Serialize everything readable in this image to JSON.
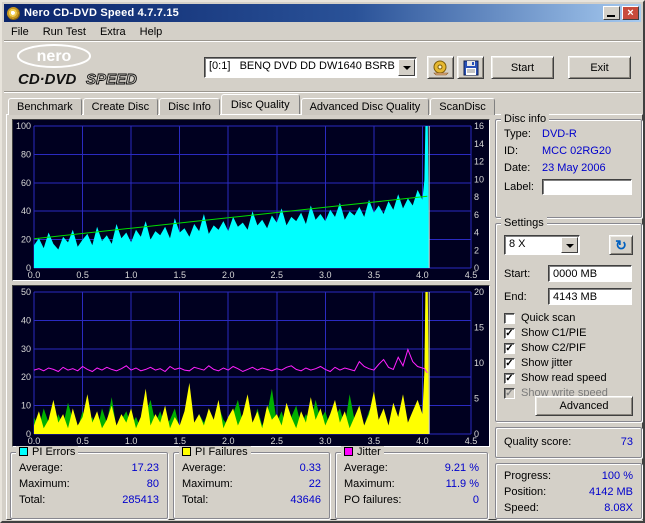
{
  "window": {
    "title": "Nero CD-DVD Speed 4.7.7.15"
  },
  "menu": {
    "items": [
      "File",
      "Run Test",
      "Extra",
      "Help"
    ]
  },
  "logo": {
    "brand": "nero",
    "cd": "CD·DVD",
    "speed": "SPEED"
  },
  "toolbar": {
    "drive": "[0:1]   BENQ DVD DD DW1640 BSRB",
    "start": "Start",
    "exit": "Exit"
  },
  "tabs": [
    "Benchmark",
    "Create Disc",
    "Disc Info",
    "Disc Quality",
    "Advanced Disc Quality",
    "ScanDisc"
  ],
  "disc_info": {
    "title": "Disc info",
    "type_label": "Type:",
    "type": "DVD-R",
    "id_label": "ID:",
    "id": "MCC 02RG20",
    "date_label": "Date:",
    "date": "23 May 2006",
    "label_label": "Label:",
    "label_value": ""
  },
  "settings": {
    "title": "Settings",
    "speed": "8 X",
    "start_label": "Start:",
    "start_value": "0000 MB",
    "end_label": "End:",
    "end_value": "4143 MB",
    "checkboxes": [
      {
        "label": "Quick scan",
        "mark": ""
      },
      {
        "label": "Show C1/PIE",
        "mark": "✓"
      },
      {
        "label": "Show C2/PIF",
        "mark": "✓"
      },
      {
        "label": "Show jitter",
        "mark": "✓"
      },
      {
        "label": "Show read speed",
        "mark": "✓"
      },
      {
        "label": "Show write speed",
        "mark": "✓",
        "disabled": true
      }
    ],
    "advanced": "Advanced"
  },
  "quality": {
    "label": "Quality score:",
    "value": "73"
  },
  "stats": {
    "pi_errors": {
      "title": "PI Errors",
      "swatch": "#00ffff",
      "rows": [
        [
          "Average:",
          "17.23"
        ],
        [
          "Maximum:",
          "80"
        ],
        [
          "Total:",
          "285413"
        ]
      ]
    },
    "pi_failures": {
      "title": "PI Failures",
      "swatch": "#ffff00",
      "rows": [
        [
          "Average:",
          "0.33"
        ],
        [
          "Maximum:",
          "22"
        ],
        [
          "Total:",
          "43646"
        ]
      ]
    },
    "jitter": {
      "title": "Jitter",
      "swatch": "#ff00ff",
      "rows": [
        [
          "Average:",
          "9.21 %"
        ],
        [
          "Maximum:",
          "11.9 %"
        ],
        [
          "PO failures:",
          "0"
        ]
      ]
    },
    "progress": {
      "rows": [
        [
          "Progress:",
          "100 %"
        ],
        [
          "Position:",
          "4142 MB"
        ],
        [
          "Speed:",
          "8.08X"
        ]
      ]
    }
  },
  "chart_data": [
    {
      "type": "area",
      "title": "PI Errors / Read speed",
      "x_range": [
        0,
        4.5
      ],
      "x_ticks": [
        0,
        0.5,
        1,
        1.5,
        2,
        2.5,
        3,
        3.5,
        4,
        4.5
      ],
      "left_axis": {
        "range": [
          0,
          100
        ],
        "ticks": [
          0,
          20,
          40,
          60,
          80,
          100
        ]
      },
      "right_axis": {
        "range": [
          0,
          16
        ],
        "ticks": [
          0,
          2,
          4,
          6,
          8,
          10,
          12,
          14,
          16
        ]
      },
      "bg": "#000020",
      "grid": "#2a2ac0",
      "marker_x": 4.07,
      "marker_color": "#d8d8d8",
      "series": [
        {
          "name": "PI Errors",
          "type": "area",
          "axis": "left",
          "color": "#00ffff",
          "x_step": 0.05,
          "values": [
            16,
            21,
            14,
            25,
            17,
            13,
            22,
            18,
            27,
            15,
            20,
            24,
            16,
            29,
            19,
            23,
            17,
            31,
            21,
            25,
            18,
            27,
            22,
            33,
            20,
            26,
            23,
            29,
            21,
            35,
            25,
            28,
            22,
            31,
            26,
            38,
            24,
            30,
            27,
            33,
            26,
            36,
            29,
            32,
            27,
            40,
            30,
            34,
            28,
            37,
            32,
            42,
            30,
            36,
            33,
            39,
            31,
            44,
            34,
            38,
            33,
            41,
            36,
            46,
            34,
            40,
            37,
            43,
            36,
            48,
            39,
            44,
            38,
            47,
            41,
            52,
            42,
            49,
            44,
            55,
            48
          ],
          "end_points": [
            [
              4.02,
              62
            ],
            [
              4.03,
              100
            ],
            [
              4.055,
              100
            ],
            [
              4.065,
              40
            ],
            [
              4.07,
              0
            ]
          ]
        },
        {
          "name": "Read speed",
          "type": "line",
          "axis": "right",
          "color": "#00dc00",
          "points": [
            [
              0,
              3.3
            ],
            [
              1,
              4.48
            ],
            [
              2,
              5.66
            ],
            [
              3,
              6.84
            ],
            [
              4.05,
              8.08
            ]
          ]
        }
      ]
    },
    {
      "type": "area",
      "title": "PI Failures / Jitter",
      "x_range": [
        0,
        4.5
      ],
      "x_ticks": [
        0,
        0.5,
        1,
        1.5,
        2,
        2.5,
        3,
        3.5,
        4,
        4.5
      ],
      "left_axis": {
        "range": [
          0,
          50
        ],
        "ticks": [
          0,
          10,
          20,
          30,
          40,
          50
        ]
      },
      "right_axis": {
        "range": [
          0,
          20
        ],
        "ticks": [
          0,
          5,
          10,
          15,
          20
        ]
      },
      "bg": "#000020",
      "grid": "#2a2ac0",
      "marker_x": 4.07,
      "marker_color": "#d8d8d8",
      "series": [
        {
          "name": "C2/PIF (green)",
          "type": "area",
          "axis": "left",
          "color": "#00b000",
          "x_step": 0.05,
          "values": [
            6,
            2,
            9,
            4,
            1,
            7,
            3,
            11,
            5,
            2,
            8,
            3,
            6,
            1,
            9,
            4,
            13,
            2,
            5,
            8,
            3,
            6,
            2,
            7,
            12,
            4,
            8,
            3,
            5,
            9,
            2,
            6,
            15,
            3,
            7,
            4,
            8,
            2,
            10,
            5,
            3,
            7,
            12,
            4,
            6,
            2,
            9,
            3,
            7,
            16,
            4,
            8,
            2,
            6,
            10,
            3,
            7,
            4,
            12,
            5,
            8,
            2,
            6,
            9,
            3,
            14,
            5,
            7,
            3,
            8,
            11,
            4,
            6,
            2,
            9,
            5,
            13,
            3,
            7,
            10,
            5
          ],
          "end_points": [
            [
              4.02,
              18
            ],
            [
              4.03,
              44
            ],
            [
              4.055,
              44
            ],
            [
              4.065,
              12
            ],
            [
              4.07,
              0
            ]
          ]
        },
        {
          "name": "PI Failures",
          "type": "area",
          "axis": "left",
          "color": "#ffff00",
          "x_step": 0.05,
          "values": [
            3,
            8,
            2,
            5,
            12,
            4,
            7,
            2,
            9,
            3,
            6,
            14,
            4,
            8,
            2,
            5,
            10,
            3,
            7,
            4,
            9,
            2,
            6,
            16,
            3,
            7,
            4,
            10,
            2,
            6,
            3,
            8,
            18,
            4,
            7,
            3,
            9,
            5,
            12,
            2,
            6,
            9,
            3,
            7,
            14,
            4,
            8,
            2,
            10,
            5,
            7,
            3,
            11,
            6,
            2,
            8,
            4,
            13,
            5,
            9,
            3,
            7,
            12,
            4,
            8,
            2,
            6,
            10,
            3,
            7,
            15,
            5,
            9,
            3,
            11,
            6,
            14,
            4,
            8,
            12,
            7
          ],
          "end_points": [
            [
              4.02,
              22
            ],
            [
              4.03,
              50
            ],
            [
              4.055,
              50
            ],
            [
              4.065,
              15
            ],
            [
              4.07,
              0
            ]
          ]
        },
        {
          "name": "Jitter",
          "type": "line",
          "axis": "right",
          "color": "#ff20ff",
          "x_step": 0.05,
          "values": [
            9.0,
            9.2,
            8.9,
            9.3,
            9.1,
            8.8,
            9.4,
            9.0,
            9.2,
            8.9,
            9.5,
            9.1,
            8.8,
            9.3,
            9.0,
            9.4,
            9.1,
            8.9,
            9.2,
            9.6,
            9.0,
            9.3,
            8.9,
            9.1,
            9.4,
            9.0,
            9.2,
            8.8,
            9.5,
            9.1,
            9.3,
            9.0,
            8.9,
            9.4,
            9.2,
            9.0,
            9.6,
            9.1,
            8.9,
            9.3,
            9.0,
            9.5,
            9.2,
            8.8,
            9.1,
            9.4,
            9.0,
            9.3,
            9.1,
            8.9,
            9.2,
            9.0,
            9.4,
            9.6,
            9.1,
            8.9,
            9.3,
            9.0,
            9.2,
            9.5,
            9.1,
            8.8,
            9.4,
            9.0,
            9.3,
            9.1,
            8.9,
            10.2,
            9.5,
            9.2,
            9.0,
            9.8,
            10.5,
            9.4,
            9.1,
            10.8,
            9.6,
            11.9,
            10.2,
            9.5,
            9.3
          ],
          "end_points": [
            [
              4.02,
              9.2
            ],
            [
              4.05,
              8.6
            ]
          ]
        }
      ]
    }
  ]
}
